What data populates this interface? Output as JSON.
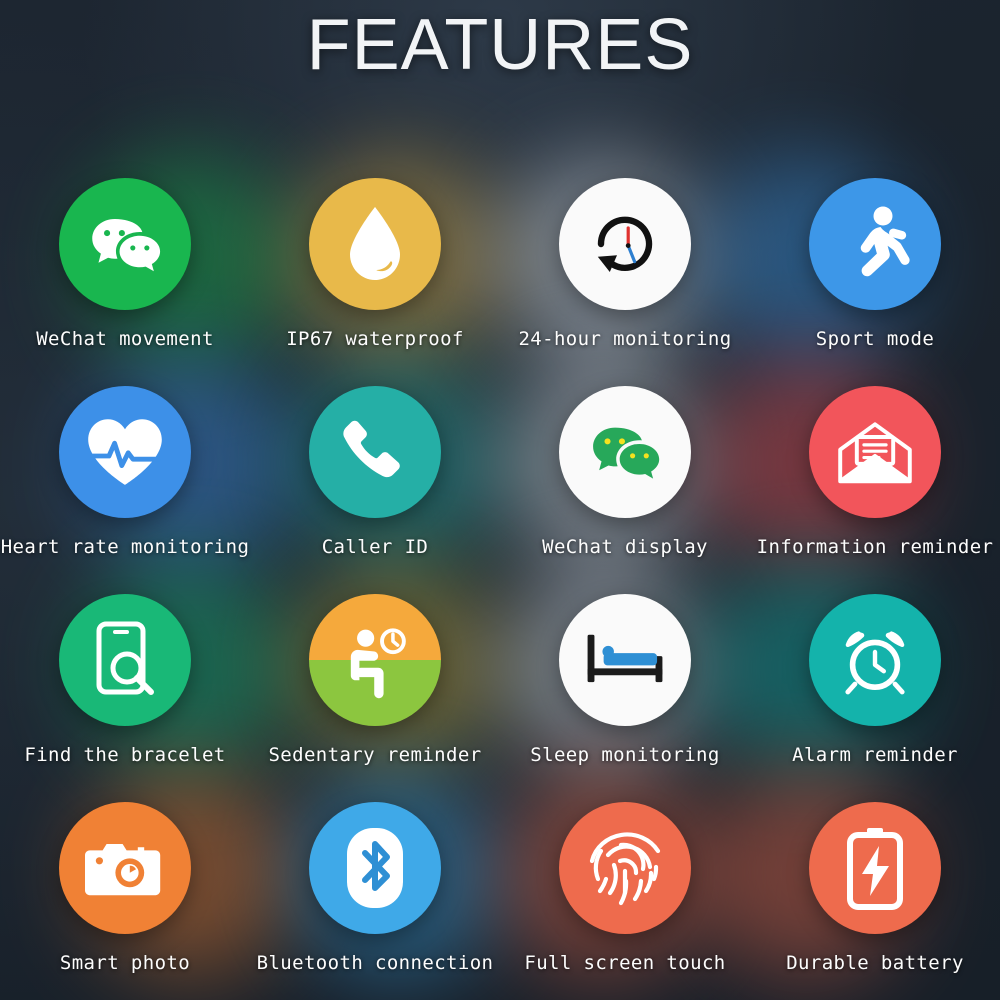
{
  "header": {
    "title": "FEATURES"
  },
  "theme": {
    "background": "#1b242e",
    "title_color": "#f2f4f6",
    "caption_color": "#fdfdfd"
  },
  "features": [
    {
      "icon": "wechat-icon",
      "label": "WeChat movement",
      "disc_color": "#19B64F",
      "glyph_color": "#ffffff",
      "glow": "#19B64F"
    },
    {
      "icon": "water-drop-icon",
      "label": "IP67 waterproof",
      "disc_color": "#E8B94A",
      "glyph_color": "#ffffff",
      "glow": "#E8B94A"
    },
    {
      "icon": "clock-history-icon",
      "label": "24-hour monitoring",
      "disc_color": "#FAFAFA",
      "glyph_color": "#111111",
      "glow": "#e8eef5"
    },
    {
      "icon": "running-person-icon",
      "label": "Sport mode",
      "disc_color": "#3D97E8",
      "glyph_color": "#ffffff",
      "glow": "#3D97E8"
    },
    {
      "icon": "heart-pulse-icon",
      "label": "Heart rate monitoring",
      "disc_color": "#3D90E8",
      "glyph_color": "#ffffff",
      "glow": "#3D90E8"
    },
    {
      "icon": "phone-handset-icon",
      "label": "Caller ID",
      "disc_color": "#25AFA6",
      "glyph_color": "#ffffff",
      "glow": "#25AFA6"
    },
    {
      "icon": "wechat-bubbles-icon",
      "label": "WeChat display",
      "disc_color": "#FAFAFA",
      "glyph_color": "#27A85A",
      "glow": "#e8eef5"
    },
    {
      "icon": "envelope-message-icon",
      "label": "Information reminder",
      "disc_color": "#F2555B",
      "glyph_color": "#ffffff",
      "glow": "#F2555B"
    },
    {
      "icon": "find-phone-icon",
      "label": "Find the bracelet",
      "disc_color": "#19B877",
      "glyph_color": "#ffffff",
      "glow": "#19B877"
    },
    {
      "icon": "sedentary-person-icon",
      "label": "Sedentary reminder",
      "disc_color": "#F5A93C",
      "glyph_color": "#ffffff",
      "glow": "#C8B03E"
    },
    {
      "icon": "bed-sleep-icon",
      "label": "Sleep monitoring",
      "disc_color": "#FAFAFA",
      "glyph_color": "#1B1B1B",
      "glow": "#e8eef5"
    },
    {
      "icon": "alarm-clock-icon",
      "label": "Alarm reminder",
      "disc_color": "#14B3AB",
      "glyph_color": "#ffffff",
      "glow": "#14B3AB"
    },
    {
      "icon": "camera-icon",
      "label": "Smart photo",
      "disc_color": "#F08135",
      "glyph_color": "#ffffff",
      "glow": "#F08135"
    },
    {
      "icon": "bluetooth-icon",
      "label": "Bluetooth connection",
      "disc_color": "#3FA9E8",
      "glyph_color": "#2E8FD4",
      "glow": "#3FA9E8"
    },
    {
      "icon": "fingerprint-icon",
      "label": "Full screen touch",
      "disc_color": "#EE6B4D",
      "glyph_color": "#ffffff",
      "glow": "#EE6B4D"
    },
    {
      "icon": "battery-bolt-icon",
      "label": "Durable battery",
      "disc_color": "#EE6B4D",
      "glyph_color": "#ffffff",
      "glow": "#EE6B4D"
    }
  ],
  "icon_extra": {
    "sedentary_top_color": "#F5A93C",
    "sedentary_bottom_color": "#8CC63F",
    "clock_hand_red": "#E0322F",
    "clock_hand_blue": "#2D7FD0",
    "bed_blanket_color": "#2E8FD4",
    "wechat_dot_color": "#F5E21F"
  }
}
